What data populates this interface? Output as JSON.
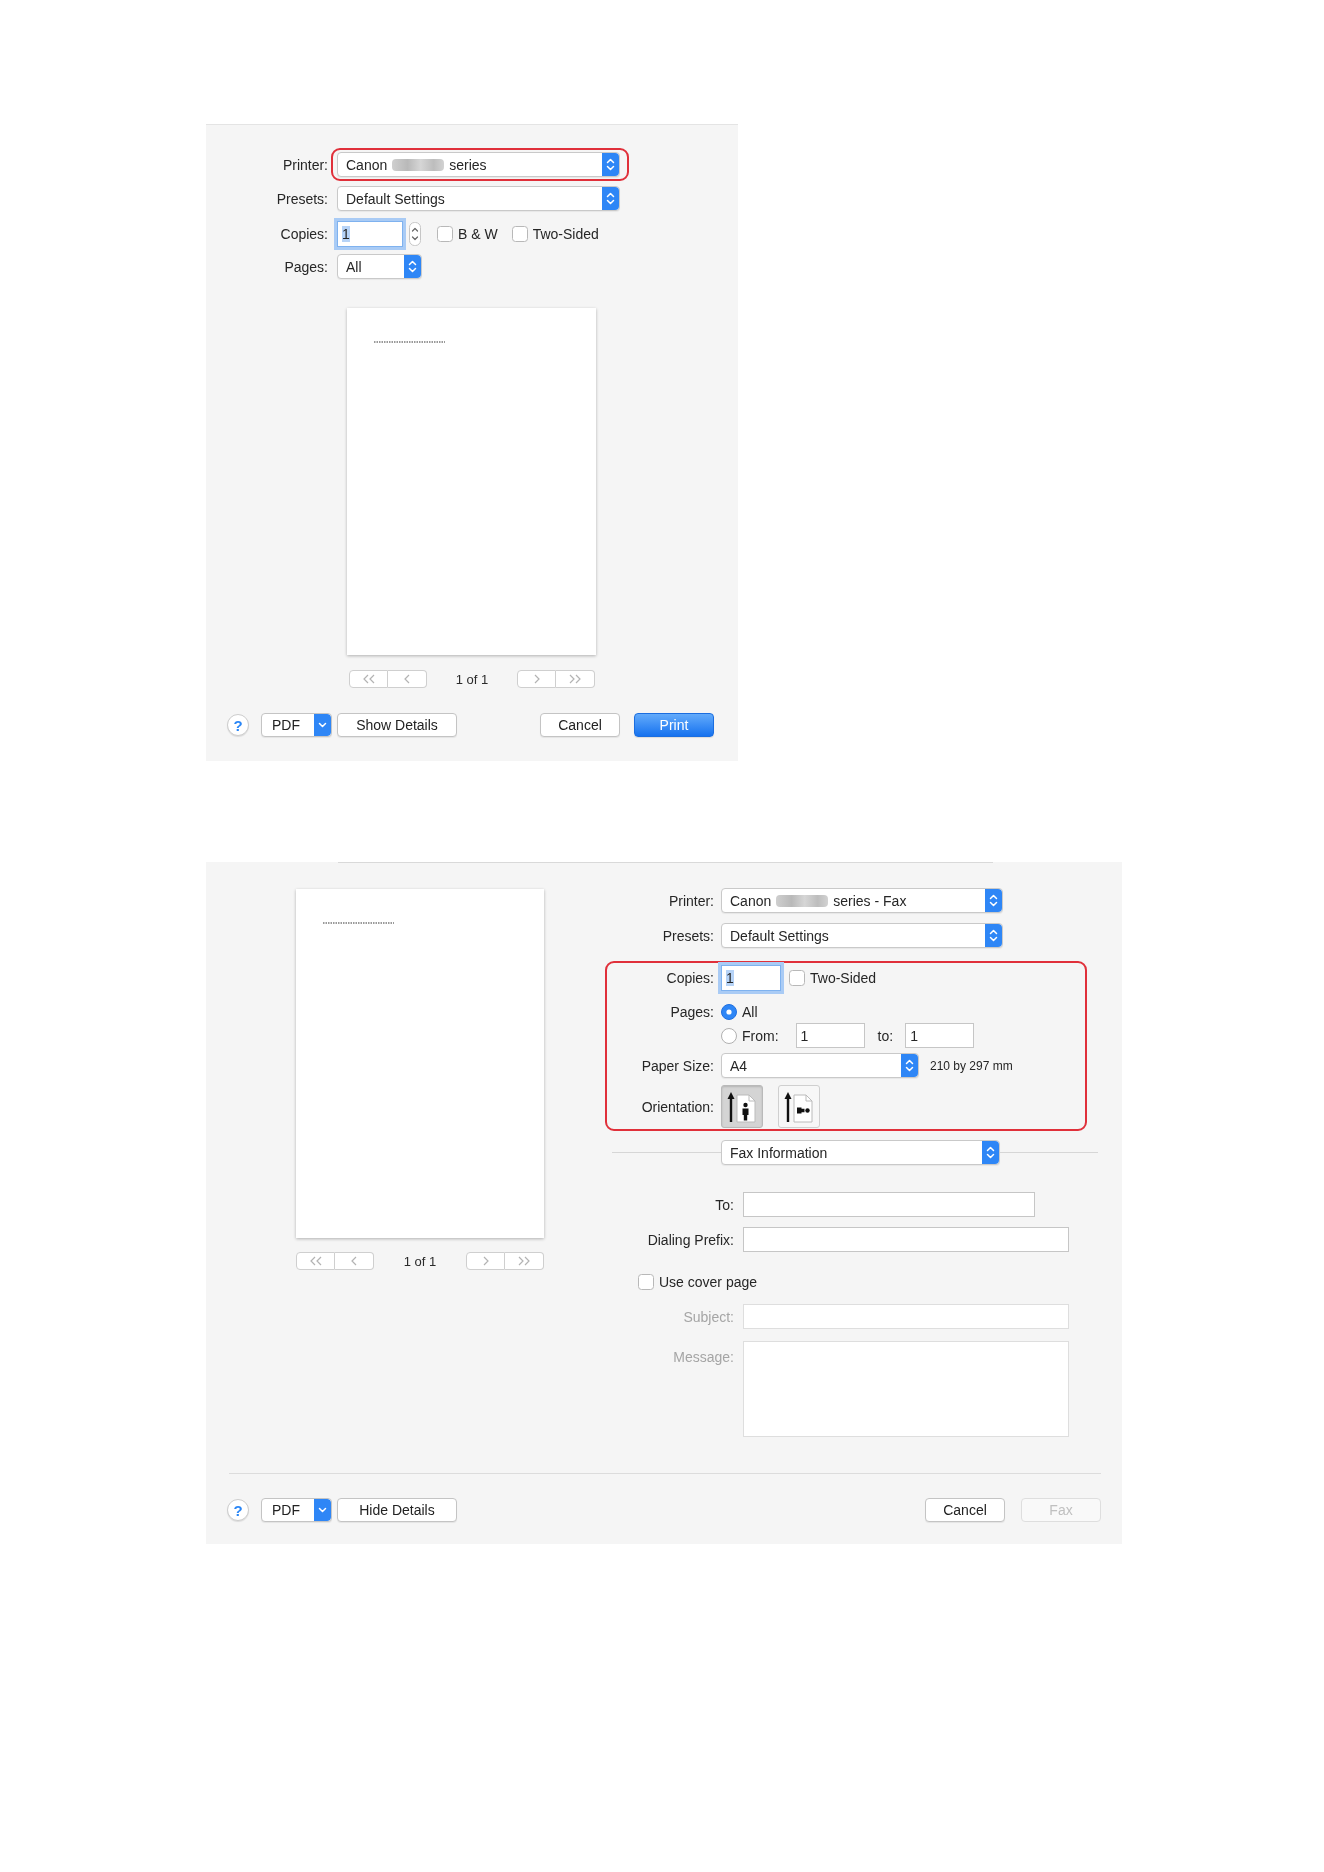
{
  "print_dialog": {
    "printer": {
      "label": "Printer:",
      "value_parts": [
        "Canon",
        "series"
      ],
      "redacted": true,
      "highlighted": true
    },
    "presets": {
      "label": "Presets:",
      "value": "Default Settings"
    },
    "copies": {
      "label": "Copies:",
      "value": "1",
      "focused": true,
      "stepper": true
    },
    "options": [
      {
        "label": "B & W",
        "checked": false
      },
      {
        "label": "Two-Sided",
        "checked": false
      }
    ],
    "pages": {
      "label": "Pages:",
      "value": "All"
    },
    "preview": {
      "page_indicator": "1 of 1",
      "navigation_enabled": false
    },
    "footer": {
      "help": "?",
      "pdf": "PDF",
      "details": "Show Details",
      "buttons": [
        {
          "label": "Cancel",
          "kind": "normal",
          "disabled": false
        },
        {
          "label": "Print",
          "kind": "default",
          "disabled": false
        }
      ]
    }
  },
  "fax_dialog": {
    "preview": {
      "page_indicator": "1 of 1",
      "navigation_enabled": false
    },
    "printer": {
      "label": "Printer:",
      "value_parts": [
        "Canon",
        "series - Fax"
      ],
      "redacted": true,
      "highlighted": false
    },
    "presets": {
      "label": "Presets:",
      "value": "Default Settings"
    },
    "details": {
      "highlighted": true,
      "copies": {
        "label": "Copies:",
        "value": "1",
        "focused": true
      },
      "options": [
        {
          "label": "Two-Sided",
          "checked": false
        }
      ],
      "pages": {
        "label": "Pages:",
        "choices": [
          {
            "label": "All",
            "selected": true
          },
          {
            "label": "From:",
            "selected": false
          }
        ],
        "from": "1",
        "to_label": "to:",
        "to": "1"
      },
      "paper_size": {
        "label": "Paper Size:",
        "value": "A4",
        "dimensions": "210 by 297 mm"
      },
      "orientation": {
        "label": "Orientation:",
        "options": [
          {
            "kind": "portrait",
            "selected": true
          },
          {
            "kind": "landscape",
            "selected": false
          }
        ]
      }
    },
    "section": {
      "value": "Fax Information"
    },
    "fields": [
      {
        "label": "To:",
        "kind": "short",
        "disabled": false
      },
      {
        "label": "Dialing Prefix:",
        "kind": "text",
        "disabled": false
      }
    ],
    "cover_page": {
      "label": "Use cover page",
      "checked": false
    },
    "cover_fields": [
      {
        "label": "Subject:",
        "kind": "text",
        "disabled": true
      },
      {
        "label": "Message:",
        "kind": "area",
        "disabled": true
      }
    ],
    "footer": {
      "help": "?",
      "pdf": "PDF",
      "details": "Hide Details",
      "buttons": [
        {
          "label": "Cancel",
          "kind": "normal",
          "disabled": false
        },
        {
          "label": "Fax",
          "kind": "normal",
          "disabled": true
        }
      ]
    }
  }
}
